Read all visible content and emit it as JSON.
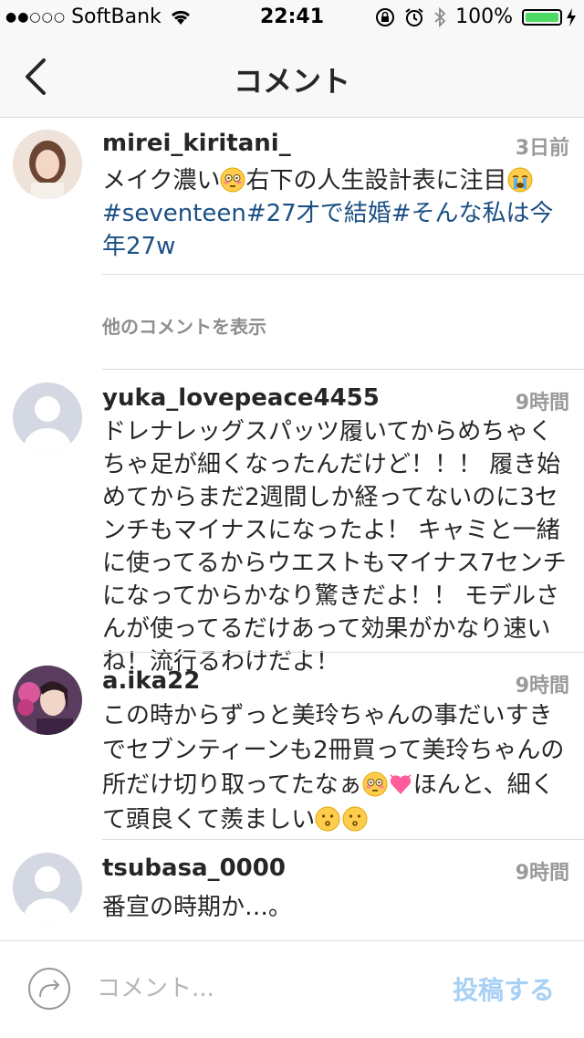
{
  "status_bar": {
    "carrier": "SoftBank",
    "time": "22:41",
    "battery_percent": "100%",
    "battery_level": 1.0,
    "signal_icon": "signal-dots-icon",
    "wifi_icon": "wifi-icon",
    "lock_icon": "rotation-lock-icon",
    "alarm_icon": "alarm-icon",
    "bluetooth_icon": "bluetooth-icon",
    "charging_icon": "charging-bolt-icon"
  },
  "nav": {
    "title": "コメント",
    "back_icon": "chevron-left-icon"
  },
  "caption": {
    "username": "mirei_kiritani_",
    "time": "3日前",
    "text_part1": "メイク濃い",
    "text_part2": "右下の人生設計表に注目",
    "hashtags": "#seventeen#27才で結婚#そんな私は今年27w",
    "emoji1": "flushed-face-emoji",
    "emoji2": "crying-face-emoji"
  },
  "more_comments_label": "他のコメントを表示",
  "comments": [
    {
      "username": "yuka_lovepeace4455",
      "time": "9時間",
      "text": "ドレナレッグスパッツ履いてからめちゃくちゃ足が細くなったんだけど！！！ 履き始めてからまだ2週間しか経ってないのに3センチもマイナスになったよ！ キャミと一緒に使ってるからウエストもマイナス7センチになってからかなり驚きだよ！！ モデルさんが使ってるだけあって効果がかなり速いね！流行るわけだよ！"
    },
    {
      "username": "a.ika22",
      "time": "9時間",
      "text_part1": "この時からずっと美玲ちゃんの事だいすきでセブンティーンも2冊買って美玲ちゃんの所だけ切り取ってたなぁ",
      "text_part2": "ほんと、細くて頭良くて羨ましい",
      "emojis": [
        "flushed-face-emoji",
        "heart-pulse-emoji",
        "kissing-face-emoji",
        "kissing-face-emoji"
      ]
    },
    {
      "username": "tsubasa_0000",
      "time": "9時間",
      "text": "番宣の時期か…。"
    }
  ],
  "input_bar": {
    "placeholder": "コメント...",
    "post_label": "投稿する",
    "share_icon": "share-arrow-icon"
  },
  "colors": {
    "hashtag": "#1b4f84",
    "post_button": "#a6d1f5",
    "battery_green": "#4cd964"
  }
}
